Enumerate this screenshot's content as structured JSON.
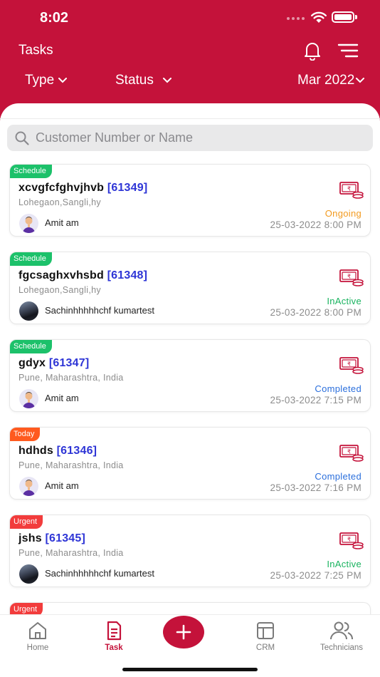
{
  "status_bar": {
    "time": "8:02"
  },
  "header": {
    "title": "Tasks",
    "filters": {
      "type": "Type",
      "status": "Status",
      "month": "Mar 2022"
    }
  },
  "search": {
    "placeholder": "Customer Number or Name"
  },
  "tasks": [
    {
      "badge": "Schedule",
      "badge_color": "#1cc16a",
      "name": "xcvgfcfghvjhvb",
      "id": "[61349]",
      "address": "Lohegaon,Sangli,hy",
      "user": "Amit am",
      "status": "Ongoing",
      "status_color": "#f29a1f",
      "datetime": "25-03-2022 8:00 PM"
    },
    {
      "badge": "Schedule",
      "badge_color": "#1cc16a",
      "name": "fgcsaghxvhsbd",
      "id": "[61348]",
      "address": "Lohegaon,Sangli,hy",
      "user": "Sachinhhhhhchf kumartest",
      "status": "InActive",
      "status_color": "#19b35f",
      "datetime": "25-03-2022 8:00 PM"
    },
    {
      "badge": "Schedule",
      "badge_color": "#1cc16a",
      "name": "gdyx",
      "id": "[61347]",
      "address": "Pune, Maharashtra, India",
      "user": "Amit am",
      "status": "Completed",
      "status_color": "#2b6fdc",
      "datetime": "25-03-2022 7:15 PM"
    },
    {
      "badge": "Today",
      "badge_color": "#ff5a1f",
      "name": "hdhds",
      "id": "[61346]",
      "address": "Pune, Maharashtra, India",
      "user": "Amit am",
      "status": "Completed",
      "status_color": "#2b6fdc",
      "datetime": "25-03-2022 7:16 PM"
    },
    {
      "badge": "Urgent",
      "badge_color": "#f23c3c",
      "name": "jshs",
      "id": "[61345]",
      "address": "Pune, Maharashtra, India",
      "user": "Sachinhhhhhchf kumartest",
      "status": "InActive",
      "status_color": "#19b35f",
      "datetime": "25-03-2022 7:25 PM"
    },
    {
      "badge": "Urgent",
      "badge_color": "#f23c3c"
    }
  ],
  "tabbar": {
    "home": "Home",
    "task": "Task",
    "crm": "CRM",
    "technicians": "Technicians"
  },
  "colors": {
    "brand": "#c4123a",
    "id_blue": "#2e35d6"
  }
}
